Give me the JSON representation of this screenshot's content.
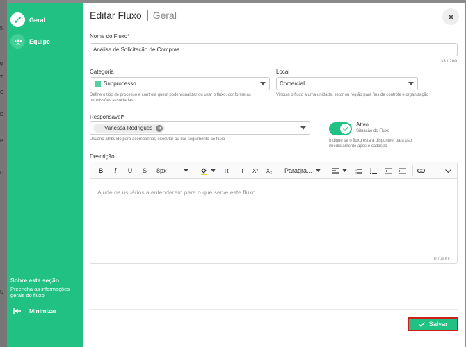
{
  "sidebar": {
    "items": [
      {
        "label": "Geral",
        "icon": "flow-icon"
      },
      {
        "label": "Equipe",
        "icon": "team-icon"
      }
    ],
    "about_title": "Sobre esta seção",
    "about_text": "Preencha as informações gerais do fluxo",
    "minimize_label": "Minimizar"
  },
  "header": {
    "title": "Editar Fluxo",
    "section": "Geral"
  },
  "form": {
    "name_label": "Nome do Fluxo*",
    "name_value": "Análise de Solicitação de Compras",
    "name_counter": "33 / 200",
    "category_label": "Categoria",
    "category_value": "Subprocesso",
    "category_help": "Define o tipo de processo e controla quem pode visualizar ou usar o fluxo, conforme as permissões associadas.",
    "local_label": "Local",
    "local_value": "Comercial",
    "local_help": "Vincula o fluxo a uma unidade, setor ou região para fins de controle e organização",
    "responsible_label": "Responsável*",
    "responsible_chip": "Vanessa Rodrigues",
    "responsible_help": "Usuário atribuído para acompanhar, executar ou dar seguimento ao fluxo",
    "active_label": "Ativo",
    "active_sub": "Situação do Fluxo",
    "active_help": "Indique se o fluxo estará disponível para uso imediatamente após o cadastro",
    "active_on": true,
    "description_label": "Descrição"
  },
  "editor": {
    "font_size": "8px",
    "paragraph": "Paragra...",
    "placeholder": "Ajude os usuários a entenderem para o que serve este fluxo ...",
    "counter": "0 / 4000"
  },
  "footer": {
    "save_label": "Salvar"
  },
  "colors": {
    "accent": "#21c184",
    "highlight_border": "#d11c1c"
  }
}
